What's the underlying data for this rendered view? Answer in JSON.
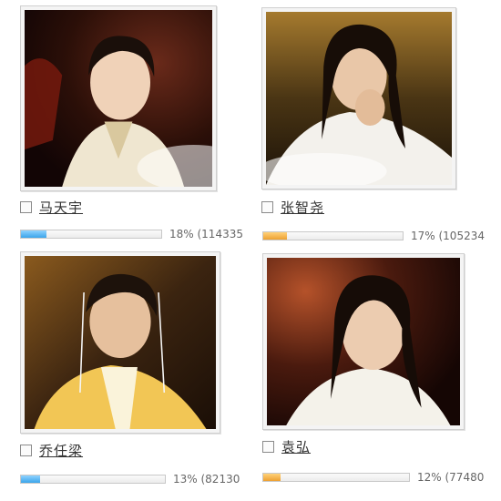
{
  "candidates": [
    {
      "name": "马天宇",
      "portrait_caption": "马天宇",
      "vote_share_percent": 18,
      "vote_text": "18% (114335",
      "bar_color": "#3aa5ea"
    },
    {
      "name": "张智尧",
      "portrait_caption": "张智尧",
      "vote_share_percent": 17,
      "vote_text": "17% (105234",
      "bar_color": "#eda032"
    },
    {
      "name": "乔任梁",
      "portrait_caption": "乔任梁",
      "vote_share_percent": 13,
      "vote_text": "13% (82130",
      "bar_color": "#3aa5ea"
    },
    {
      "name": "袁弘",
      "portrait_caption": "袁弘",
      "vote_share_percent": 12,
      "vote_text": "12% (77480",
      "bar_color": "#eda032"
    }
  ]
}
